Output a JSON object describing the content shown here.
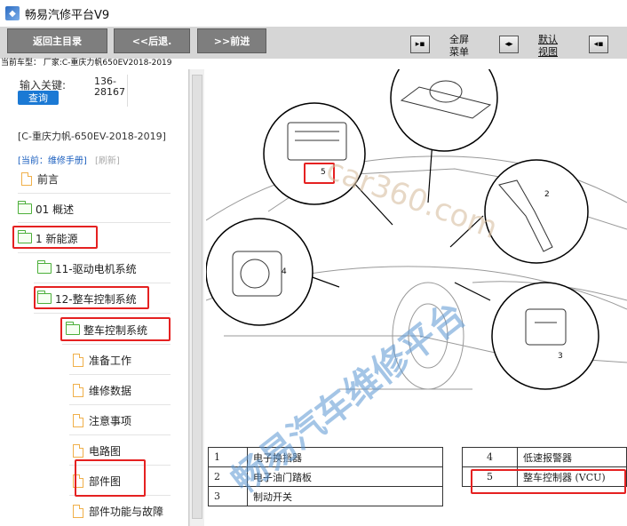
{
  "window": {
    "title": "畅易汽修平台V9",
    "icon": "app-logo-icon"
  },
  "toolbar": {
    "back_main": "返回主目录",
    "prev": "<<后退.",
    "next": ">>前进",
    "fullscreen_line1": "全屏",
    "fullscreen_line2": "菜单",
    "default_view_line1": "默认",
    "default_view_line2": "视图"
  },
  "current_car": "当前车型： 厂家:C-重庆力帆650EV2018-2019",
  "search": {
    "label": "输入关键:",
    "value_line1": "136-",
    "value_line2": "28167",
    "button": "查询"
  },
  "car_info": {
    "name": "[C-重庆力帆-650EV-2018-2019]",
    "current_link": "[当前：维修手册]",
    "refresh": "[刷新]"
  },
  "tree": [
    {
      "label": "前言",
      "type": "doc"
    },
    {
      "label": "01 概述",
      "type": "folder"
    },
    {
      "label": "1 新能源",
      "type": "folder"
    },
    {
      "label": "11-驱动电机系统",
      "type": "folder"
    },
    {
      "label": "12-整车控制系统",
      "type": "folder"
    },
    {
      "label": "整车控制系统",
      "type": "folder"
    },
    {
      "label": "准备工作",
      "type": "doc"
    },
    {
      "label": "维修数据",
      "type": "doc"
    },
    {
      "label": "注意事项",
      "type": "doc"
    },
    {
      "label": "电路图",
      "type": "doc"
    },
    {
      "label": "部件图",
      "type": "doc"
    },
    {
      "label": "部件功能与故障",
      "type": "doc"
    }
  ],
  "diagram": {
    "callouts": [
      "5",
      "2",
      "4",
      "3"
    ],
    "watermark": "畅易汽车维修平台",
    "watermark_url": "car360.com"
  },
  "parts_table_left": [
    {
      "num": "1",
      "name": "电子换挡器"
    },
    {
      "num": "2",
      "name": "电子油门踏板"
    },
    {
      "num": "3",
      "name": "制动开关"
    }
  ],
  "parts_table_right": [
    {
      "num": "4",
      "name": "低速报警器"
    },
    {
      "num": "5",
      "name": "整车控制器 (VCU)"
    }
  ],
  "colors": {
    "toolbar_bg": "#d6d6d6",
    "button_bg": "#7e7e7e",
    "search_btn": "#1b79d4",
    "highlight": "#e52121",
    "folder": "#4caf3a",
    "doc": "#f0b04a"
  }
}
